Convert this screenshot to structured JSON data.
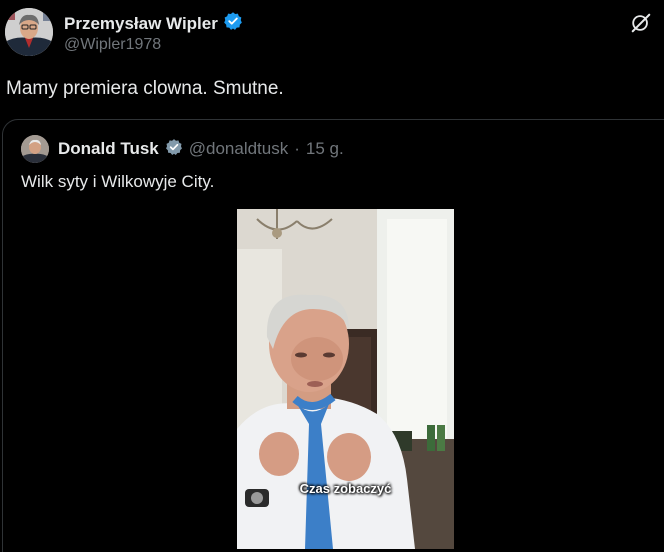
{
  "author": {
    "name": "Przemysław Wipler",
    "handle": "@Wipler1978",
    "verified_color": "#1d9bf0"
  },
  "tweet": {
    "text": "Mamy premiera clowna. Smutne."
  },
  "icons": {
    "top_right": "grok-icon",
    "verified": "verified-badge-icon"
  },
  "quoted": {
    "name": "Donald Tusk",
    "handle": "@donaldtusk",
    "separator": "·",
    "time": "15 g.",
    "text": "Wilk syty i Wilkowyje City.",
    "video_caption": "Czas zobaczyć"
  },
  "colors": {
    "background": "#000000",
    "text_primary": "#e7e9ea",
    "text_secondary": "#71767b",
    "border": "#2f3336"
  }
}
